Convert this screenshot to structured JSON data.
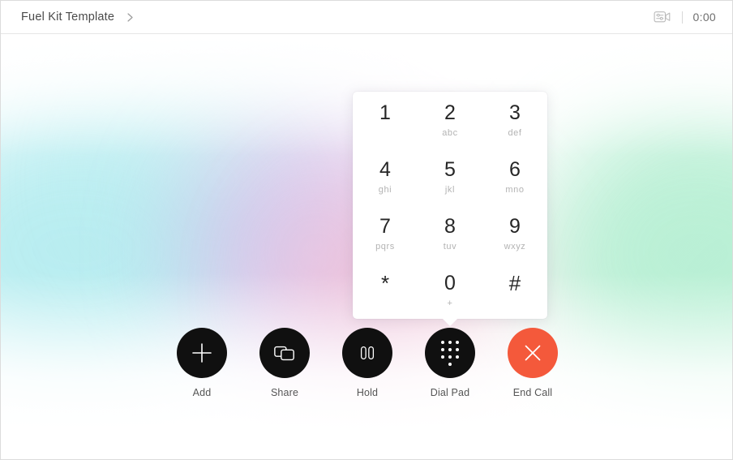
{
  "header": {
    "breadcrumb_title": "Fuel Kit Template",
    "chevron_icon": "chevron-right-icon",
    "camera_settings_icon": "video-settings-icon",
    "separator": "|",
    "call_timer": "0:00"
  },
  "dialpad": {
    "keys": [
      {
        "digit": "1",
        "letters": ""
      },
      {
        "digit": "2",
        "letters": "abc"
      },
      {
        "digit": "3",
        "letters": "def"
      },
      {
        "digit": "4",
        "letters": "ghi"
      },
      {
        "digit": "5",
        "letters": "jkl"
      },
      {
        "digit": "6",
        "letters": "mno"
      },
      {
        "digit": "7",
        "letters": "pqrs"
      },
      {
        "digit": "8",
        "letters": "tuv"
      },
      {
        "digit": "9",
        "letters": "wxyz"
      },
      {
        "digit": "*",
        "letters": ""
      },
      {
        "digit": "0",
        "letters": "+"
      },
      {
        "digit": "#",
        "letters": ""
      }
    ]
  },
  "controls": [
    {
      "label": "Add",
      "icon": "plus-icon",
      "variant": "dark"
    },
    {
      "label": "Share",
      "icon": "screen-share-icon",
      "variant": "dark"
    },
    {
      "label": "Hold",
      "icon": "pause-icon",
      "variant": "dark"
    },
    {
      "label": "Dial Pad",
      "icon": "dial-pad-dots-icon",
      "variant": "dark"
    },
    {
      "label": "End Call",
      "icon": "close-x-icon",
      "variant": "danger"
    }
  ],
  "colors": {
    "end_call": "#F4593B",
    "control_dark": "#101010",
    "panel": "#FFFFFF",
    "text_primary": "#262626",
    "text_muted": "#B3B3B3",
    "gradient_cyan": "#8FE3E8",
    "gradient_purple": "#D3A8E6",
    "gradient_pink": "#F3B6C6",
    "gradient_green": "#8FE6BB"
  }
}
